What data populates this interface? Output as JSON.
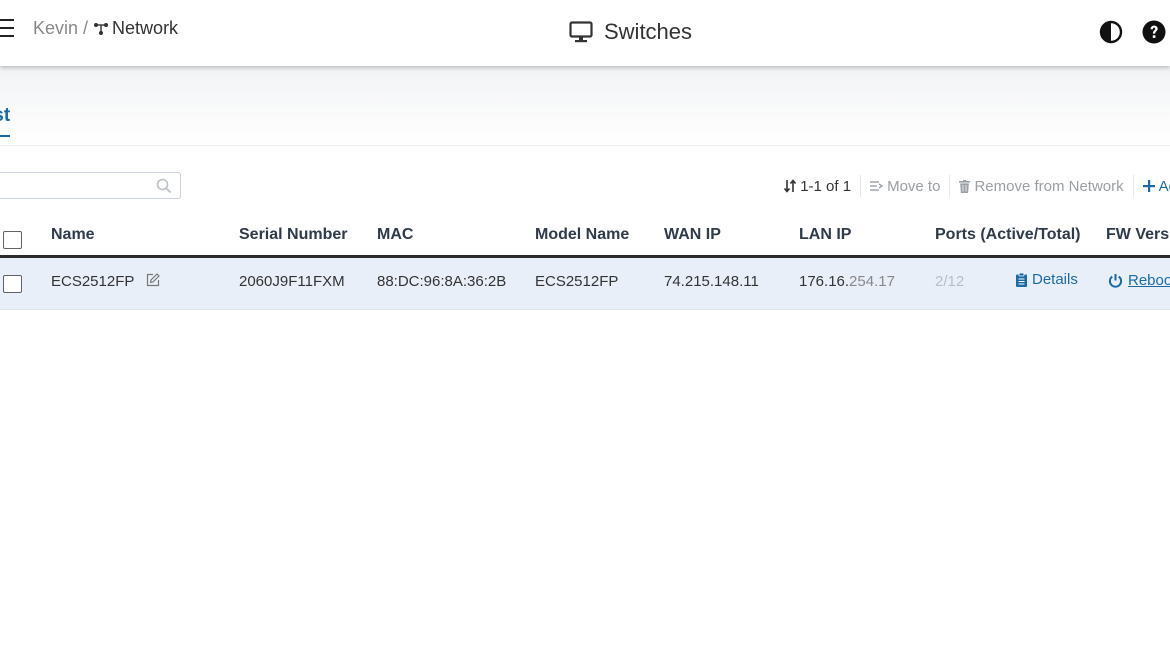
{
  "header": {
    "breadcrumb_root": "Kevin",
    "breadcrumb_sep": "/",
    "breadcrumb_current": "Network",
    "title": "Switches",
    "title_icon": "monitor-icon",
    "right_icons": [
      "contrast-icon",
      "help-icon"
    ]
  },
  "tabs": [
    {
      "label": "List",
      "visible_label": "ist",
      "active": true
    }
  ],
  "search": {
    "placeholder": "",
    "value": ""
  },
  "toolbar": {
    "count": "1-1 of 1",
    "move_to": "Move to",
    "remove": "Remove from Network",
    "add": "Ad"
  },
  "table": {
    "columns": [
      "Name",
      "Serial Number",
      "MAC",
      "Model Name",
      "WAN IP",
      "LAN IP",
      "Ports (Active/Total)",
      "FW Versi"
    ],
    "rows": [
      {
        "name": "ECS2512FP",
        "serial": "2060J9F11FXM",
        "mac": "88:DC:96:8A:36:2B",
        "model": "ECS2512FP",
        "wan_ip": "74.215.148.11",
        "lan_ip_a": "176.16.",
        "lan_ip_b": "254.17",
        "ports": "2/12",
        "details": "Details",
        "reboot": "Reboo"
      }
    ]
  },
  "colors": {
    "accent": "#1b6aa5",
    "row_highlight": "#e9eff9",
    "muted": "#9aa0a6"
  }
}
